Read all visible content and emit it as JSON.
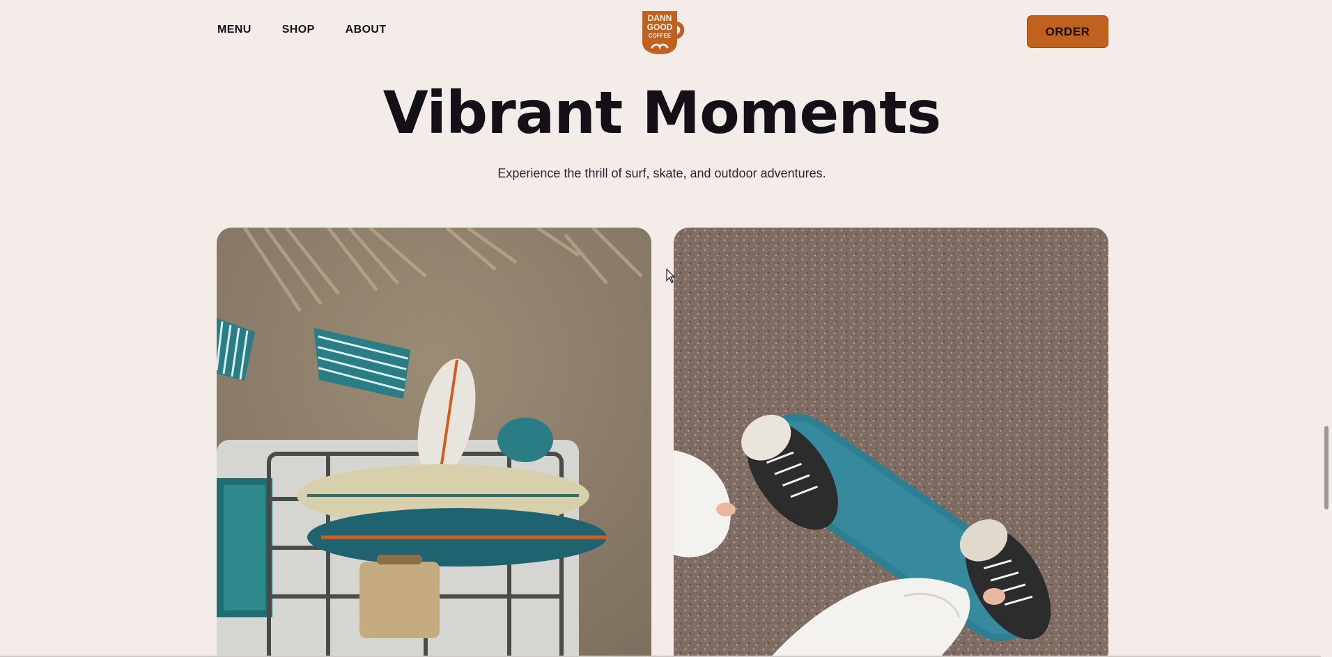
{
  "header": {
    "nav": [
      {
        "label": "MENU"
      },
      {
        "label": "SHOP"
      },
      {
        "label": "ABOUT"
      }
    ],
    "logo": {
      "line1": "DANN",
      "line2": "GOOD",
      "line3": "COFFEE"
    },
    "order_label": "ORDER"
  },
  "hero": {
    "title": "Vibrant Moments",
    "subtitle": "Experience the thrill of surf, skate, and outdoor adventures."
  },
  "colors": {
    "background": "#F4ECE9",
    "accent": "#C0621F",
    "text": "#141018"
  },
  "icons": {
    "logo": "coffee-mug-logo-icon",
    "cursor": "mouse-cursor-icon"
  }
}
